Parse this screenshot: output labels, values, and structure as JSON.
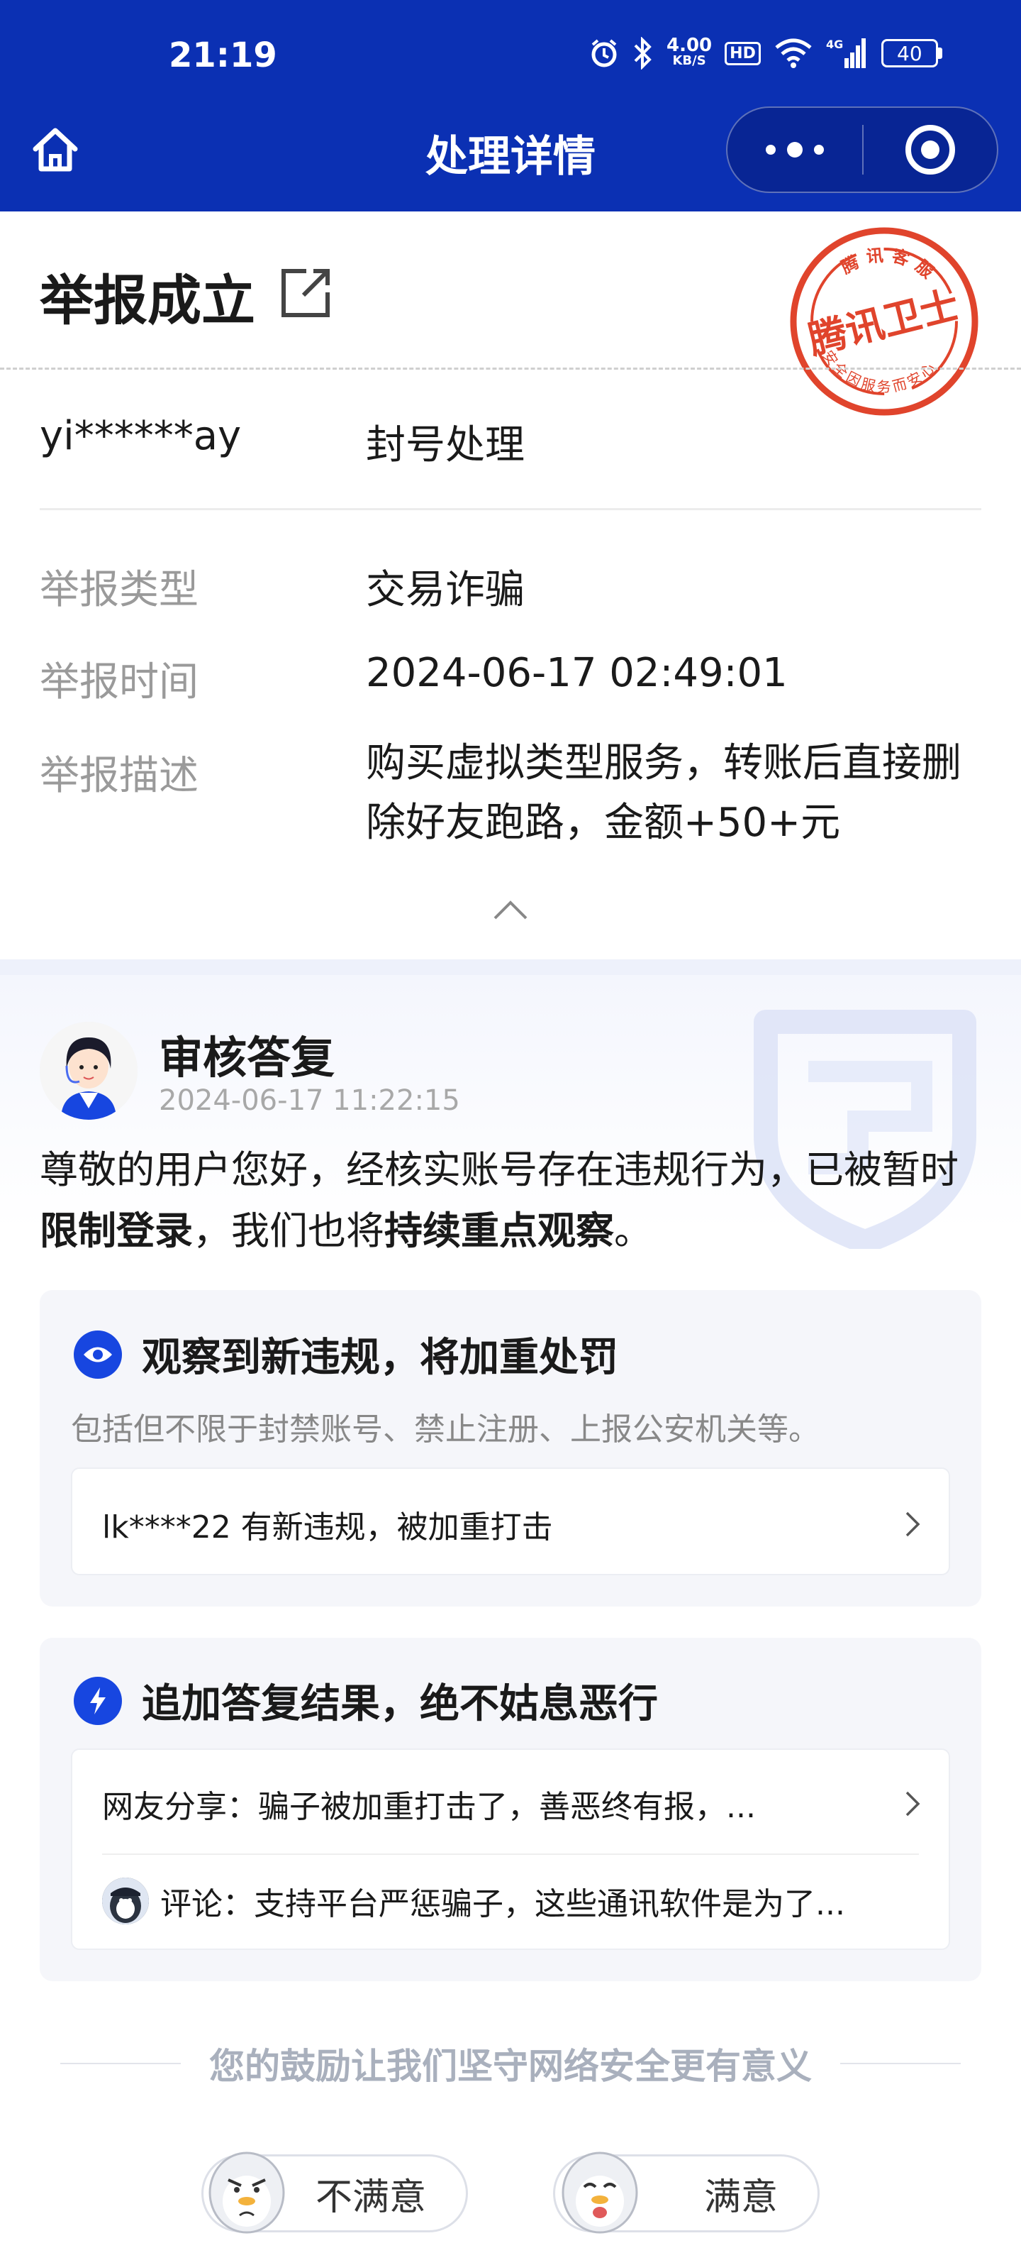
{
  "status_bar": {
    "time": "21:19",
    "net_speed_value": "4.00",
    "net_speed_unit": "KB/S",
    "hd_badge": "HD",
    "signal_label": "4G",
    "battery": "40",
    "icons": [
      "alarm-icon",
      "bluetooth-icon",
      "wifi-icon",
      "signal-icon",
      "battery-icon"
    ]
  },
  "nav": {
    "title": "处理详情",
    "home_icon": "home-icon",
    "more_icon": "more-dots-icon",
    "close_icon": "target-close-icon"
  },
  "report": {
    "status_title": "举报成立",
    "stamp": {
      "top_text": "腾讯客服",
      "center_text": "腾讯卫士",
      "bottom_text": "安全因服务而安心",
      "color": "#e0442c"
    },
    "account": "yi******ay",
    "action": "封号处理",
    "fields": [
      {
        "label": "举报类型",
        "value": "交易诈骗"
      },
      {
        "label": "举报时间",
        "value": "2024-06-17 02:49:01"
      },
      {
        "label": "举报描述",
        "value": "购买虚拟类型服务，转账后直接删除好友跑路，金额+50+元"
      }
    ]
  },
  "reply": {
    "title": "审核答复",
    "time": "2024-06-17 11:22:15",
    "text_normal": "尊敬的用户您好，经核实账号存在违规行为，已被暂时",
    "text_bold_1": "限制登录",
    "text_mid": "，我们也将",
    "text_bold_2": "持续重点观察",
    "text_end": "。"
  },
  "panel_violation": {
    "title": "观察到新违规，将加重处罚",
    "subtitle": "包括但不限于封禁账号、禁止注册、上报公安机关等。",
    "item": "lk****22 有新违规，被加重打击"
  },
  "panel_followup": {
    "title": "追加答复结果，绝不姑息恶行",
    "share_item": "网友分享：骗子被加重打击了，善恶终有报，...",
    "comment_item": "评论：支持平台严惩骗子，这些通讯软件是为了..."
  },
  "feedback": {
    "prompt": "您的鼓励让我们坚守网络安全更有意义",
    "unsatisfied": "不满意",
    "satisfied": "满意"
  },
  "colors": {
    "header_bg": "#0b30b3",
    "accent": "#1746e0",
    "label_gray": "#9a9a9a",
    "stamp_red": "#e0442c"
  }
}
